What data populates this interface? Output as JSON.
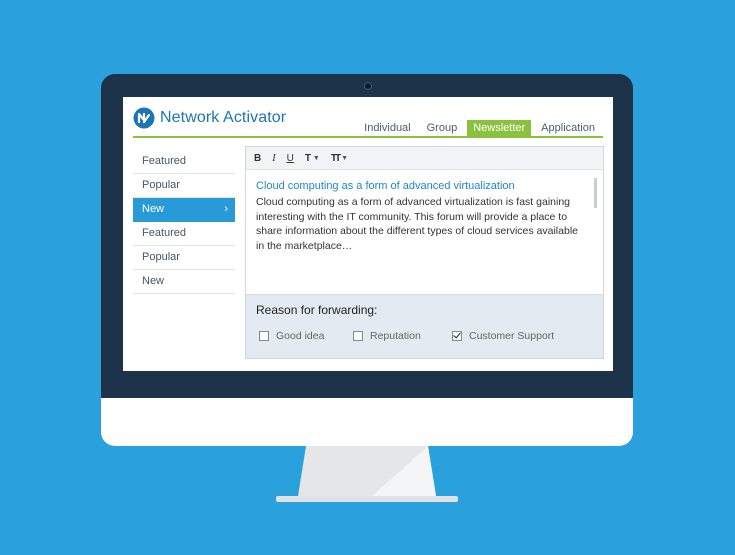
{
  "app": {
    "name": "Network Activator",
    "logo_icon": "n-circle-logo-icon"
  },
  "tabs": [
    {
      "label": "Individual",
      "active": false
    },
    {
      "label": "Group",
      "active": false
    },
    {
      "label": "Newsletter",
      "active": true
    },
    {
      "label": "Application",
      "active": false
    }
  ],
  "sidebar": {
    "items": [
      {
        "label": "Featured",
        "active": false
      },
      {
        "label": "Popular",
        "active": false
      },
      {
        "label": "New",
        "active": true,
        "icon": "chevron-right-icon"
      },
      {
        "label": "Featured",
        "active": false
      },
      {
        "label": "Popular",
        "active": false
      },
      {
        "label": "New",
        "active": false
      }
    ]
  },
  "toolbar": {
    "bold": "B",
    "italic": "I",
    "underline": "U",
    "font": "T",
    "font_size": "TT"
  },
  "editor": {
    "title": "Cloud computing as a form of advanced virtualization",
    "body": "Cloud computing as a form of advanced virtualization is fast gaining interesting with the IT community. This forum will provide a place to share information about the different types of cloud services available in the marketplace…"
  },
  "forwarding": {
    "label": "Reason for forwarding:",
    "options": [
      {
        "label": "Good idea",
        "checked": false
      },
      {
        "label": "Reputation",
        "checked": false
      },
      {
        "label": "Customer Support",
        "checked": true
      }
    ]
  },
  "colors": {
    "background": "#2aa0dd",
    "brand": "#1b75b7",
    "accent_green": "#8cc13f",
    "nav_active": "#289ad8",
    "monitor_bezel": "#1d3349"
  }
}
